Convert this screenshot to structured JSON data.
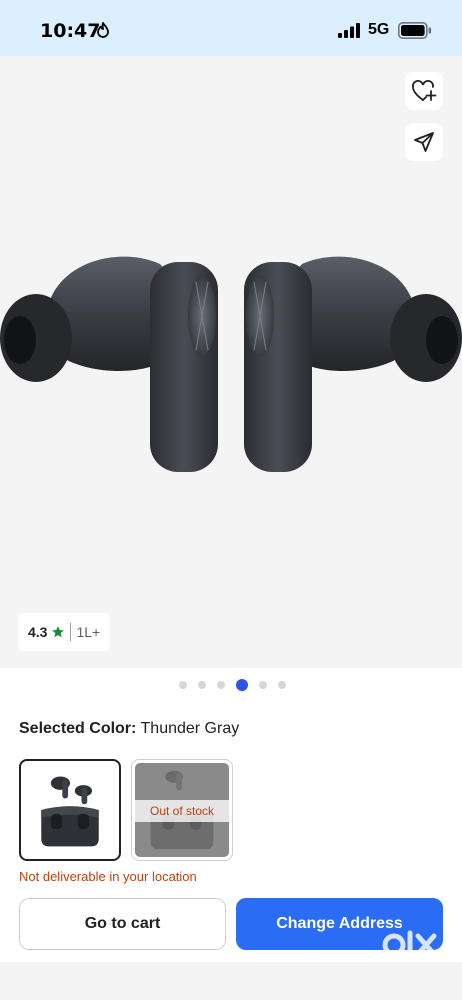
{
  "status_bar": {
    "time": "10:47",
    "network": "5G"
  },
  "product": {
    "rating_value": "4.3",
    "rating_count": "1L+",
    "gallery_dots": 6,
    "gallery_active_index": 3
  },
  "color_selector": {
    "label": "Selected Color:",
    "value": "Thunder Gray",
    "options": [
      {
        "name": "Thunder Gray",
        "selected": true
      },
      {
        "name": "Out of stock option",
        "badge": "Out of stock",
        "selected": false
      }
    ]
  },
  "delivery": {
    "message": "Not deliverable in your location"
  },
  "actions": {
    "go_to_cart": "Go to cart",
    "change_address": "Change Address"
  },
  "watermark": {
    "brand": "OLX"
  },
  "colors": {
    "accent": "#2a6df4",
    "warning": "#c2410c",
    "star": "#1b8a3a",
    "statusbar": "#dcefff"
  }
}
